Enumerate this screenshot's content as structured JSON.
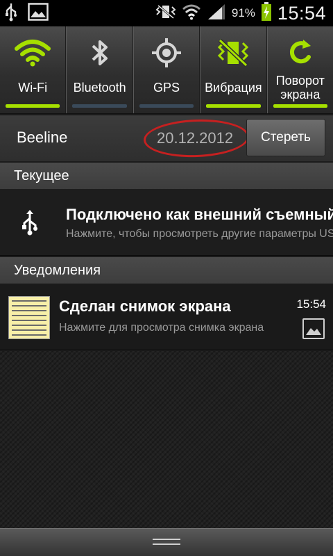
{
  "status_bar": {
    "icons": [
      "usb-icon",
      "gallery-icon",
      "vibrate-icon",
      "wifi-icon",
      "signal-icon",
      "battery-charging-icon"
    ],
    "battery_percent": "91%",
    "time": "15:54"
  },
  "quick_toggles": [
    {
      "label": "Wi-Fi",
      "icon": "wifi-icon",
      "active": true
    },
    {
      "label": "Bluetooth",
      "icon": "bluetooth-icon",
      "active": false
    },
    {
      "label": "GPS",
      "icon": "gps-icon",
      "active": false
    },
    {
      "label": "Вибрация",
      "icon": "vibrate-icon",
      "active": true
    },
    {
      "label": "Поворот экрана",
      "icon": "rotate-icon",
      "active": true
    }
  ],
  "operator": {
    "name": "Beeline",
    "date": "20.12.2012",
    "clear_label": "Стереть"
  },
  "sections": {
    "current": "Текущее",
    "notifications": "Уведомления"
  },
  "ongoing": {
    "title": "Подключено как внешний съемный диск",
    "subtitle": "Нажмите, чтобы просмотреть другие параметры USB"
  },
  "notification": {
    "title": "Сделан снимок экрана",
    "subtitle": "Нажмите для просмотра снимка экрана",
    "time": "15:54"
  },
  "colors": {
    "accent_green": "#a6e000",
    "highlight_red": "#c62020"
  }
}
